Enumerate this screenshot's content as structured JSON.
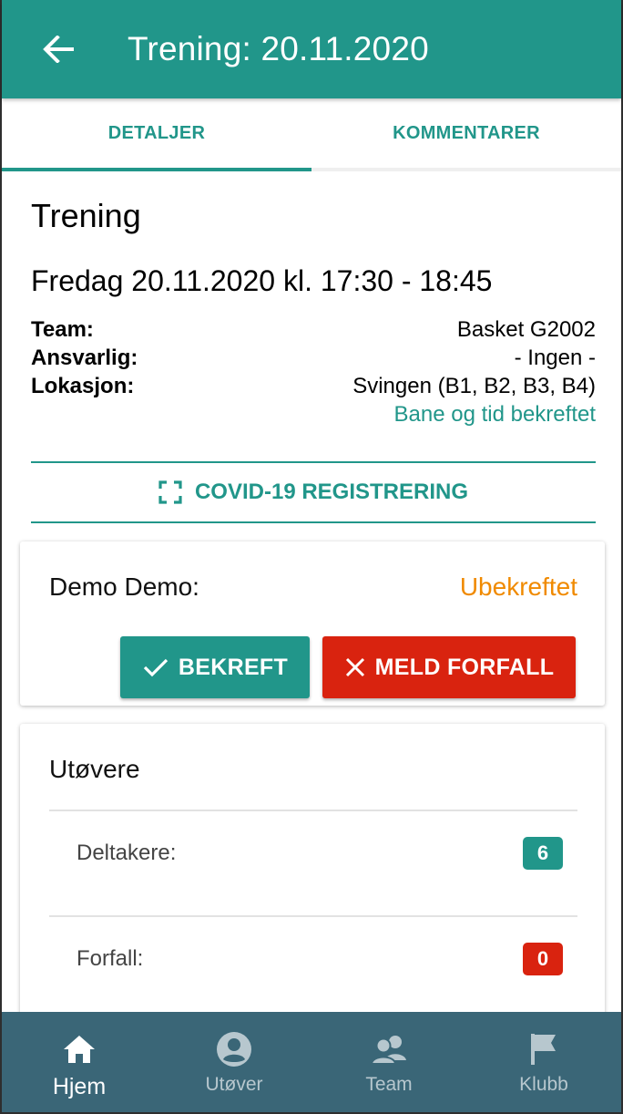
{
  "appbar": {
    "back_icon": "arrow-left-icon",
    "title": "Trening: 20.11.2020"
  },
  "tabs": [
    {
      "label": "DETALJER",
      "active": true
    },
    {
      "label": "KOMMENTARER",
      "active": false
    }
  ],
  "event": {
    "type": "Trening",
    "datetime": "Fredag 20.11.2020 kl. 17:30 - 18:45",
    "team_label": "Team:",
    "team_value": "Basket G2002",
    "responsible_label": "Ansvarlig:",
    "responsible_value": "- Ingen -",
    "location_label": "Lokasjon:",
    "location_value": "Svingen (B1, B2, B3, B4)",
    "location_status": "Bane og tid bekreftet"
  },
  "covid": {
    "icon": "qr-scan-icon",
    "label": "COVID-19 REGISTRERING"
  },
  "attendance": {
    "name": "Demo Demo:",
    "status": "Ubekreftet",
    "confirm_label": "BEKREFT",
    "absent_label": "MELD FORFALL"
  },
  "athletes": {
    "title": "Utøvere",
    "participants_label": "Deltakere:",
    "participants_count": "6",
    "absent_label": "Forfall:",
    "absent_count": "0"
  },
  "bottom_nav": [
    {
      "label": "Hjem",
      "icon": "home-icon",
      "active": true
    },
    {
      "label": "Utøver",
      "icon": "account-circle-icon",
      "active": false
    },
    {
      "label": "Team",
      "icon": "team-icon",
      "active": false
    },
    {
      "label": "Klubb",
      "icon": "flag-icon",
      "active": false
    }
  ],
  "colors": {
    "primary": "#21968a",
    "danger": "#d9230f",
    "warning": "#f08a00",
    "nav_bg": "#3a6677"
  }
}
